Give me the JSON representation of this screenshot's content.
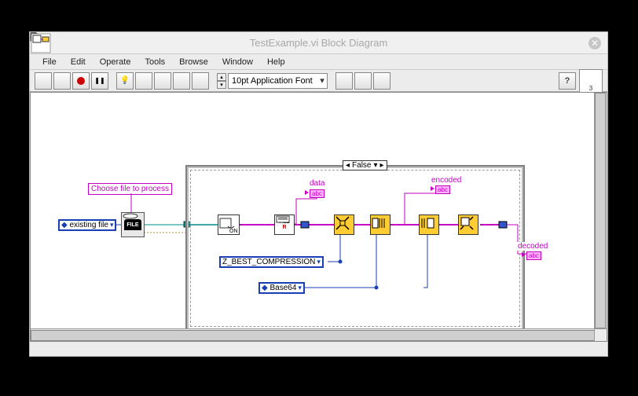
{
  "window": {
    "title": "TestExample.vi Block Diagram"
  },
  "menu": {
    "file": "File",
    "edit": "Edit",
    "operate": "Operate",
    "tools": "Tools",
    "browse": "Browse",
    "window": "Window",
    "help": "Help"
  },
  "toolbar": {
    "font": "10pt Application Font",
    "context_help_num": "3"
  },
  "diagram": {
    "comment_choose": "Choose file to process",
    "const_existing_file": "existing file",
    "const_compression": "Z_BEST_COMPRESSION",
    "const_base64": "Base64",
    "case_value": "False",
    "labels": {
      "data": "data",
      "encoded": "encoded",
      "decoded": "decoded"
    },
    "abc_tag": "abc"
  }
}
